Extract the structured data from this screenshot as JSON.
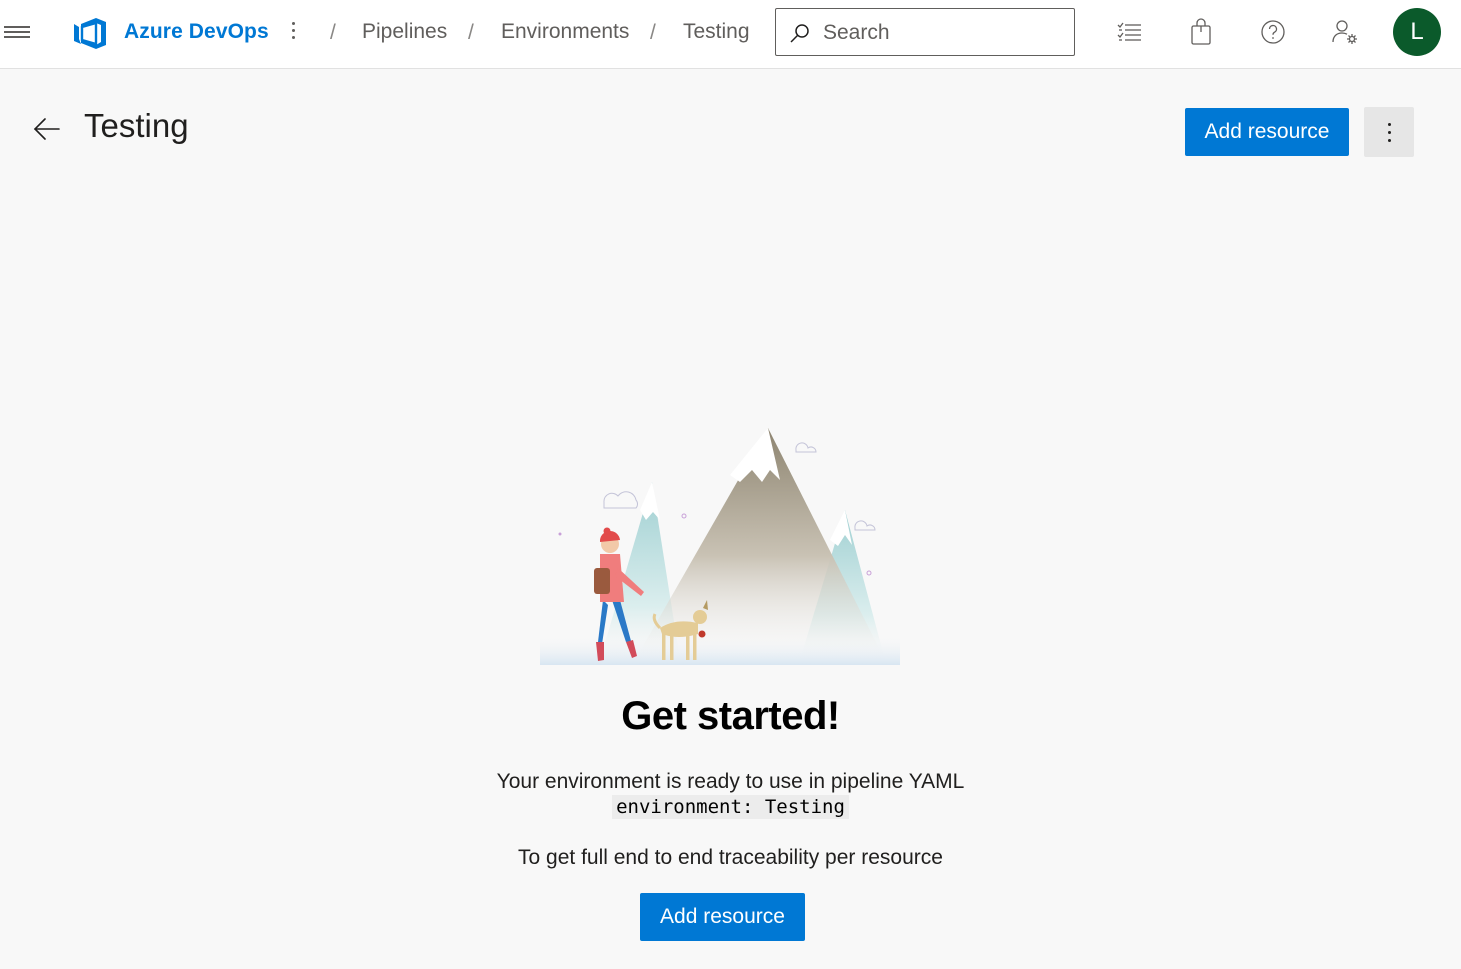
{
  "header": {
    "brand": "Azure DevOps",
    "breadcrumbs": [
      {
        "label": "Pipelines"
      },
      {
        "label": "Environments"
      },
      {
        "label": "Testing"
      }
    ],
    "search": {
      "placeholder": "Search",
      "value": ""
    },
    "avatar_initial": "L",
    "avatar_color": "#0b5a2b",
    "icons": [
      "menu-icon",
      "azure-devops-logo",
      "more-vertical-icon",
      "search-icon",
      "task-list-icon",
      "marketplace-bag-icon",
      "help-icon",
      "user-settings-icon"
    ]
  },
  "page": {
    "title": "Testing",
    "add_resource_label": "Add resource"
  },
  "empty_state": {
    "headline": "Get started!",
    "description": "Your environment is ready to use in pipeline YAML",
    "yaml_snippet": "environment: Testing",
    "trace_text": "To get full end to end traceability per resource",
    "add_resource_label": "Add resource"
  },
  "colors": {
    "accent": "#0078d4",
    "background": "#f8f8f8",
    "topbar": "#ffffff"
  }
}
